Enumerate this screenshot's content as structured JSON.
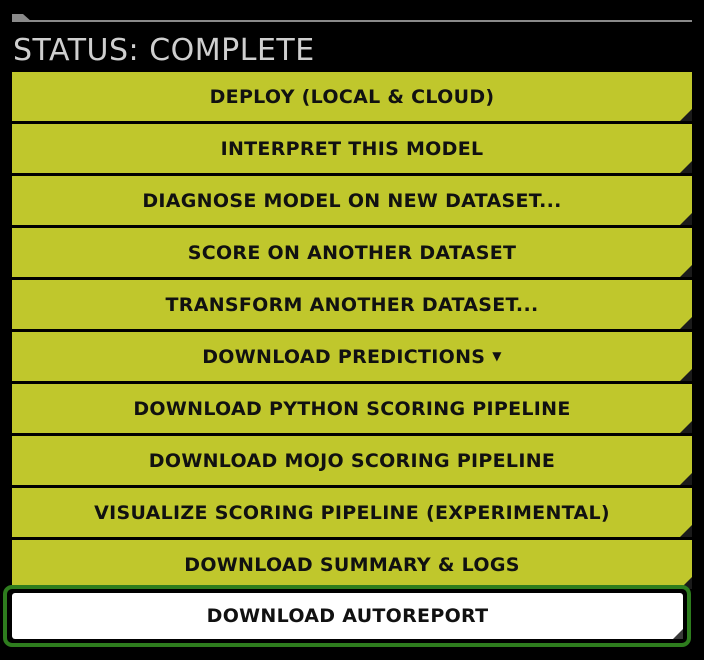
{
  "status": {
    "text": "STATUS: COMPLETE"
  },
  "actions": [
    {
      "label": "DEPLOY (LOCAL & CLOUD)"
    },
    {
      "label": "INTERPRET THIS MODEL"
    },
    {
      "label": "DIAGNOSE MODEL ON NEW DATASET..."
    },
    {
      "label": "SCORE ON ANOTHER DATASET"
    },
    {
      "label": "TRANSFORM ANOTHER DATASET..."
    },
    {
      "label": "DOWNLOAD PREDICTIONS",
      "icon": "caret-down-icon"
    },
    {
      "label": "DOWNLOAD PYTHON SCORING PIPELINE"
    },
    {
      "label": "DOWNLOAD MOJO SCORING PIPELINE"
    },
    {
      "label": "VISUALIZE SCORING PIPELINE (EXPERIMENTAL)"
    },
    {
      "label": "DOWNLOAD SUMMARY & LOGS"
    }
  ],
  "autoreport": {
    "label": "DOWNLOAD AUTOREPORT",
    "highlight_color": "#2e7d1e"
  },
  "colors": {
    "background": "#000000",
    "button": "#c0c72c",
    "button_text": "#111111",
    "status_text": "#cfcfcf"
  }
}
